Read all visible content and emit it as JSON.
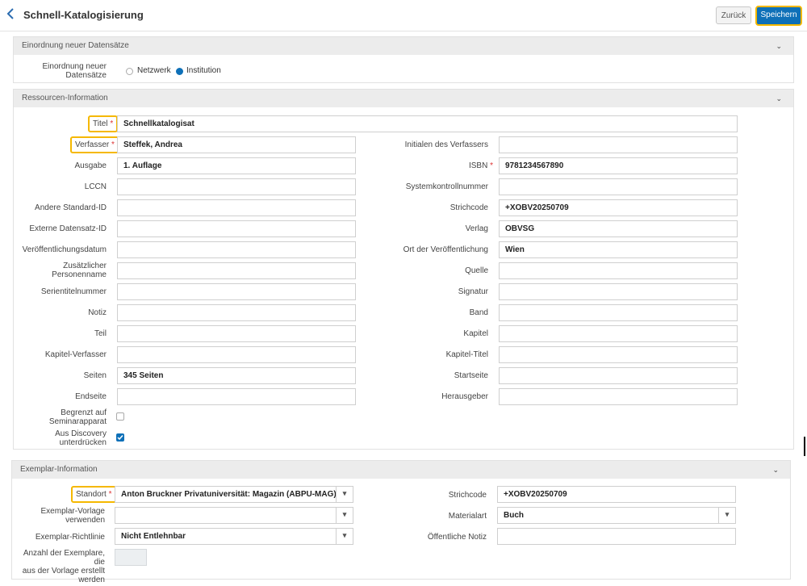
{
  "header": {
    "title": "Schnell-Katalogisierung",
    "back_label": "Zurück",
    "save_label": "Speichern"
  },
  "sections": {
    "einordnung": {
      "title": "Einordnung neuer Datensätze",
      "field_label": "Einordnung neuer Datensätze",
      "options": [
        "Netzwerk",
        "Institution"
      ],
      "selected": "Institution"
    },
    "ressourcen": {
      "title": "Ressourcen-Information"
    },
    "exemplar": {
      "title": "Exemplar-Information"
    }
  },
  "required_marker": "*",
  "fields": {
    "titel": {
      "label": "Titel",
      "value": "Schnellkatalogisat"
    },
    "verfasser": {
      "label": "Verfasser",
      "value": "Steffek, Andrea"
    },
    "initialen": {
      "label": "Initialen des Verfassers",
      "value": ""
    },
    "ausgabe": {
      "label": "Ausgabe",
      "value": "1. Auflage"
    },
    "isbn": {
      "label": "ISBN",
      "value": "9781234567890"
    },
    "lccn": {
      "label": "LCCN",
      "value": ""
    },
    "systemkontrollnummer": {
      "label": "Systemkontrollnummer",
      "value": ""
    },
    "andere_standard_id": {
      "label": "Andere Standard-ID",
      "value": ""
    },
    "strichcode": {
      "label": "Strichcode",
      "value": "+XOBV20250709"
    },
    "externe_datensatz_id": {
      "label": "Externe Datensatz-ID",
      "value": ""
    },
    "verlag": {
      "label": "Verlag",
      "value": "OBVSG"
    },
    "veroeffentlichungsdatum": {
      "label": "Veröffentlichungsdatum",
      "value": ""
    },
    "ort": {
      "label": "Ort der Veröffentlichung",
      "value": "Wien"
    },
    "zus_personenname": {
      "label_line1": "Zusätzlicher",
      "label_line2": "Personenname",
      "value": ""
    },
    "quelle": {
      "label": "Quelle",
      "value": ""
    },
    "serientitelnummer": {
      "label": "Serientitelnummer",
      "value": ""
    },
    "signatur": {
      "label": "Signatur",
      "value": ""
    },
    "notiz": {
      "label": "Notiz",
      "value": ""
    },
    "band": {
      "label": "Band",
      "value": ""
    },
    "teil": {
      "label": "Teil",
      "value": ""
    },
    "kapitel": {
      "label": "Kapitel",
      "value": ""
    },
    "kapitel_verfasser": {
      "label": "Kapitel-Verfasser",
      "value": ""
    },
    "kapitel_titel": {
      "label": "Kapitel-Titel",
      "value": ""
    },
    "seiten": {
      "label": "Seiten",
      "value": "345 Seiten"
    },
    "startseite": {
      "label": "Startseite",
      "value": ""
    },
    "endseite": {
      "label": "Endseite",
      "value": ""
    },
    "herausgeber": {
      "label": "Herausgeber",
      "value": ""
    },
    "begrenzt": {
      "label_line1": "Begrenzt auf",
      "label_line2": "Seminarapparat",
      "checked": false
    },
    "discovery": {
      "label_line1": "Aus Discovery",
      "label_line2": "unterdrücken",
      "checked": true
    }
  },
  "exemplar": {
    "standort": {
      "label": "Standort",
      "value": "Anton Bruckner Privatuniversität: Magazin (ABPU-MAG)"
    },
    "strichcode": {
      "label": "Strichcode",
      "value": "+XOBV20250709"
    },
    "vorlage": {
      "label_line1": "Exemplar-Vorlage",
      "label_line2": "verwenden",
      "value": ""
    },
    "materialart": {
      "label": "Materialart",
      "value": "Buch"
    },
    "richtlinie": {
      "label": "Exemplar-Richtlinie",
      "value": "Nicht Entlehnbar"
    },
    "notiz": {
      "label": "Öffentliche Notiz",
      "value": ""
    },
    "anzahl": {
      "label_line1": "Anzahl der Exemplare, die",
      "label_line2": "aus der Vorlage erstellt",
      "label_line3": "werden",
      "value": ""
    }
  },
  "icons": {
    "back": "chevron-left-icon",
    "collapse": "chevron-down-icon",
    "dropdown": "caret-down-icon"
  },
  "colors": {
    "primary": "#0e70b8",
    "highlight": "#f5b800",
    "required": "#dd3333"
  }
}
